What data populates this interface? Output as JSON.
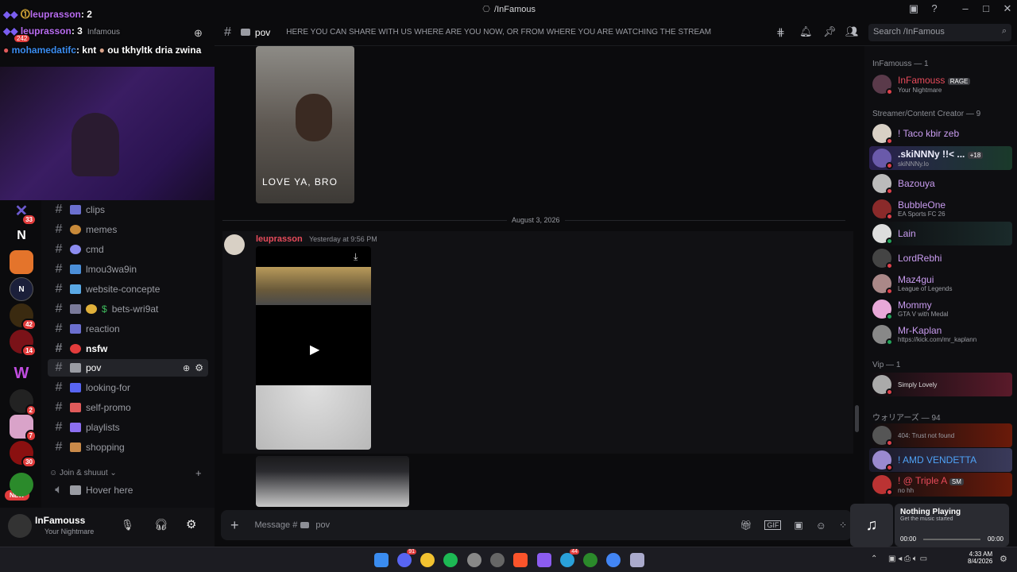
{
  "window": {
    "title": "/InFamous"
  },
  "overlay": {
    "line1_user": "leuprasson",
    "line1_count": ": 2",
    "line2_user": "leuprasson",
    "line2_count": ": 3",
    "line2_under": "Infamous",
    "line3_user": "mohamedatifc",
    "line3_text": ": knt",
    "line3_rest": "ou tkhyltk dria zwina",
    "viewer_badge": "242"
  },
  "servers": [
    {
      "badge": "33"
    },
    {
      "badge": ""
    },
    {
      "badge": ""
    },
    {
      "badge": ""
    },
    {
      "badge": "42"
    },
    {
      "badge": "14"
    },
    {
      "badge": ""
    },
    {
      "badge": "2"
    },
    {
      "badge": "7"
    },
    {
      "badge": "30"
    },
    {
      "badge": "NEW"
    }
  ],
  "channels": [
    {
      "name": "clips"
    },
    {
      "name": "memes"
    },
    {
      "name": "cmd"
    },
    {
      "name": "lmou3wa9in"
    },
    {
      "name": "website-concepte"
    },
    {
      "name": "bets-wri9at",
      "prefix": "$"
    },
    {
      "name": "reaction"
    },
    {
      "name": "nsfw"
    },
    {
      "name": "pov"
    },
    {
      "name": "looking-for"
    },
    {
      "name": "self-promo"
    },
    {
      "name": "playlists"
    },
    {
      "name": "shopping"
    }
  ],
  "category_join": "Join & shuuut",
  "voice_channel": "Hover here",
  "user": {
    "name": "InFamouss",
    "status": "Your Nightmare"
  },
  "header": {
    "channel": "pov",
    "topic": "HERE YOU CAN SHARE WITH US WHERE ARE YOU NOW, OR FROM WHERE YOU ARE WATCHING THE STREAM",
    "search_placeholder": "Search /InFamous"
  },
  "messages": {
    "image_caption": "LOVE YA, BRO",
    "date_divider": "August 3, 2026",
    "author": "leuprasson",
    "timestamp": "Yesterday at 9:56 PM"
  },
  "composer": {
    "placeholder": "Message #",
    "channel": "pov"
  },
  "members": {
    "cat1": "InFamouss — 1",
    "cat2": "Streamer/Content Creator — 9",
    "cat3": "Vip — 1",
    "cat4": "ウォリアーズ — 94",
    "list": [
      {
        "name": "InFamouss",
        "tag": "RAGE",
        "status": "Your Nightmare",
        "color": "#e84b5b"
      },
      {
        "name": "! Taco kbir zeb",
        "status": "",
        "color": "#c99cf0"
      },
      {
        "name": ".skiNNNy !!< ...",
        "tag": "+18",
        "status": "skiNNNy.lo",
        "color": "#f0f0ff"
      },
      {
        "name": "Bazouya",
        "status": "",
        "color": "#c99cf0"
      },
      {
        "name": "BubbleOne",
        "status": "EA Sports FC 26",
        "color": "#c99cf0"
      },
      {
        "name": "Lain",
        "status": "",
        "color": "#c99cf0"
      },
      {
        "name": "LordRebhi",
        "status": "",
        "color": "#c99cf0"
      },
      {
        "name": "Maz4gui",
        "status": "League of Legends",
        "color": "#c99cf0"
      },
      {
        "name": "Mommy",
        "status": "GTA V with Medal",
        "color": "#c99cf0"
      },
      {
        "name": "Mr-Kaplan",
        "status": "https://kick.com/mr_kaplann",
        "color": "#c99cf0"
      },
      {
        "name": "",
        "status": "Simply Lovely",
        "color": "#e84b5b"
      },
      {
        "name": "",
        "status": "404: Trust not found",
        "color": "#e84b5b"
      },
      {
        "name": "! AMD VENDETTA",
        "status": "",
        "color": "#4fa3f7"
      },
      {
        "name": "! @ Triple A",
        "tag": "SM",
        "status": "no hh",
        "color": "#e84b5b"
      }
    ]
  },
  "now_playing": {
    "title": "Nothing Playing",
    "subtitle": "Get the music started",
    "start": "00:00",
    "end": "00:00"
  },
  "clock": {
    "time": "4:33 AM",
    "date": "8/4/2026"
  },
  "taskbar_badges": {
    "discord": "91",
    "telegram": "44"
  }
}
